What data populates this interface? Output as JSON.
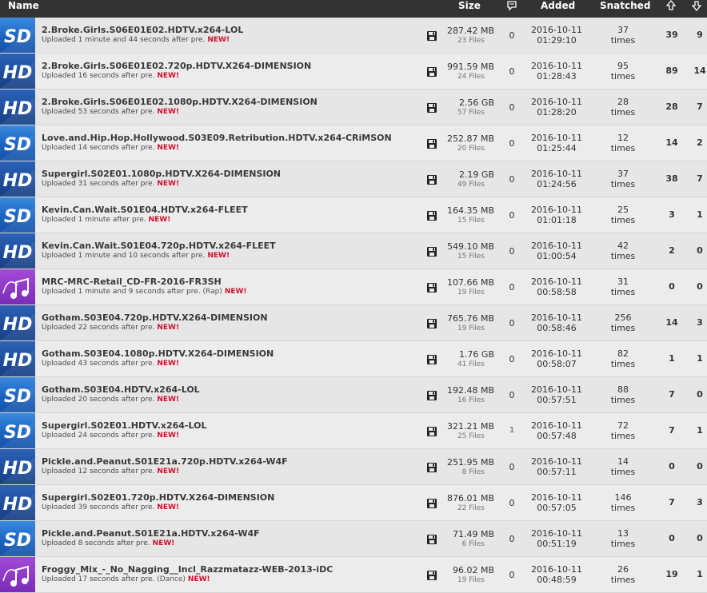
{
  "header": {
    "name": "Name",
    "size": "Size",
    "added": "Added",
    "snatched": "Snatched",
    "comments_icon": "comment-icon",
    "seeders_icon": "arrow-up-icon",
    "leechers_icon": "arrow-down-icon"
  },
  "colors": {
    "header_bg": "#333333",
    "new_badge": "#d0112b",
    "sd_badge": "#1b63c0",
    "hd_badge": "#1e4c9a",
    "music_badge": "#7a2cb7"
  },
  "torrents": [
    {
      "category": "sd",
      "title": "2.Broke.Girls.S06E01E02.HDTV.x264-LOL",
      "uploaded": "Uploaded 1 minute and 44 seconds after pre.",
      "tag": "",
      "new": "NEW!",
      "size": "287.42 MB",
      "files": "23 Files",
      "comments": "0",
      "date": "2016-10-11",
      "time": "01:29:10",
      "snatched": "37",
      "snatched_unit": "times",
      "seeders": "39",
      "leechers": "9"
    },
    {
      "category": "hd",
      "title": "2.Broke.Girls.S06E01E02.720p.HDTV.X264-DIMENSION",
      "uploaded": "Uploaded 16 seconds after pre.",
      "tag": "",
      "new": "NEW!",
      "size": "991.59 MB",
      "files": "24 Files",
      "comments": "0",
      "date": "2016-10-11",
      "time": "01:28:43",
      "snatched": "95",
      "snatched_unit": "times",
      "seeders": "89",
      "leechers": "14"
    },
    {
      "category": "hd",
      "title": "2.Broke.Girls.S06E01E02.1080p.HDTV.X264-DIMENSION",
      "uploaded": "Uploaded 53 seconds after pre.",
      "tag": "",
      "new": "NEW!",
      "size": "2.56 GB",
      "files": "57 Files",
      "comments": "0",
      "date": "2016-10-11",
      "time": "01:28:20",
      "snatched": "28",
      "snatched_unit": "times",
      "seeders": "28",
      "leechers": "7"
    },
    {
      "category": "sd",
      "title": "Love.and.Hip.Hop.Hollywood.S03E09.Retribution.HDTV.x264-CRiMSON",
      "uploaded": "Uploaded 14 seconds after pre.",
      "tag": "",
      "new": "NEW!",
      "size": "252.87 MB",
      "files": "20 Files",
      "comments": "0",
      "date": "2016-10-11",
      "time": "01:25:44",
      "snatched": "12",
      "snatched_unit": "times",
      "seeders": "14",
      "leechers": "2"
    },
    {
      "category": "hd",
      "title": "Supergirl.S02E01.1080p.HDTV.X264-DIMENSION",
      "uploaded": "Uploaded 31 seconds after pre.",
      "tag": "",
      "new": "NEW!",
      "size": "2.19 GB",
      "files": "49 Files",
      "comments": "0",
      "date": "2016-10-11",
      "time": "01:24:56",
      "snatched": "37",
      "snatched_unit": "times",
      "seeders": "38",
      "leechers": "7"
    },
    {
      "category": "sd",
      "title": "Kevin.Can.Wait.S01E04.HDTV.x264-FLEET",
      "uploaded": "Uploaded 1 minute after pre.",
      "tag": "",
      "new": "NEW!",
      "size": "164.35 MB",
      "files": "15 Files",
      "comments": "0",
      "date": "2016-10-11",
      "time": "01:01:18",
      "snatched": "25",
      "snatched_unit": "times",
      "seeders": "3",
      "leechers": "1"
    },
    {
      "category": "hd",
      "title": "Kevin.Can.Wait.S01E04.720p.HDTV.x264-FLEET",
      "uploaded": "Uploaded 1 minute and 10 seconds after pre.",
      "tag": "",
      "new": "NEW!",
      "size": "549.10 MB",
      "files": "15 Files",
      "comments": "0",
      "date": "2016-10-11",
      "time": "01:00:54",
      "snatched": "42",
      "snatched_unit": "times",
      "seeders": "2",
      "leechers": "0"
    },
    {
      "category": "music",
      "title": "MRC-MRC-Retail_CD-FR-2016-FR3SH",
      "uploaded": "Uploaded 1 minute and 9 seconds after pre.",
      "tag": "(Rap)",
      "new": "NEW!",
      "size": "107.66 MB",
      "files": "19 Files",
      "comments": "0",
      "date": "2016-10-11",
      "time": "00:58:58",
      "snatched": "31",
      "snatched_unit": "times",
      "seeders": "0",
      "leechers": "0"
    },
    {
      "category": "hd",
      "title": "Gotham.S03E04.720p.HDTV.X264-DIMENSION",
      "uploaded": "Uploaded 22 seconds after pre.",
      "tag": "",
      "new": "NEW!",
      "size": "765.76 MB",
      "files": "19 Files",
      "comments": "0",
      "date": "2016-10-11",
      "time": "00:58:46",
      "snatched": "256",
      "snatched_unit": "times",
      "seeders": "14",
      "leechers": "3"
    },
    {
      "category": "hd",
      "title": "Gotham.S03E04.1080p.HDTV.X264-DIMENSION",
      "uploaded": "Uploaded 43 seconds after pre.",
      "tag": "",
      "new": "NEW!",
      "size": "1.76 GB",
      "files": "41 Files",
      "comments": "0",
      "date": "2016-10-11",
      "time": "00:58:07",
      "snatched": "82",
      "snatched_unit": "times",
      "seeders": "1",
      "leechers": "1"
    },
    {
      "category": "sd",
      "title": "Gotham.S03E04.HDTV.x264-LOL",
      "uploaded": "Uploaded 20 seconds after pre.",
      "tag": "",
      "new": "NEW!",
      "size": "192.48 MB",
      "files": "16 Files",
      "comments": "0",
      "date": "2016-10-11",
      "time": "00:57:51",
      "snatched": "88",
      "snatched_unit": "times",
      "seeders": "7",
      "leechers": "0"
    },
    {
      "category": "sd",
      "title": "Supergirl.S02E01.HDTV.x264-LOL",
      "uploaded": "Uploaded 24 seconds after pre.",
      "tag": "",
      "new": "NEW!",
      "size": "321.21 MB",
      "files": "25 Files",
      "comments": "1",
      "date": "2016-10-11",
      "time": "00:57:48",
      "snatched": "72",
      "snatched_unit": "times",
      "seeders": "7",
      "leechers": "1"
    },
    {
      "category": "hd",
      "title": "Pickle.and.Peanut.S01E21a.720p.HDTV.x264-W4F",
      "uploaded": "Uploaded 12 seconds after pre.",
      "tag": "",
      "new": "NEW!",
      "size": "251.95 MB",
      "files": "8 Files",
      "comments": "0",
      "date": "2016-10-11",
      "time": "00:57:11",
      "snatched": "14",
      "snatched_unit": "times",
      "seeders": "0",
      "leechers": "0"
    },
    {
      "category": "hd",
      "title": "Supergirl.S02E01.720p.HDTV.X264-DIMENSION",
      "uploaded": "Uploaded 39 seconds after pre.",
      "tag": "",
      "new": "NEW!",
      "size": "876.01 MB",
      "files": "22 Files",
      "comments": "0",
      "date": "2016-10-11",
      "time": "00:57:05",
      "snatched": "146",
      "snatched_unit": "times",
      "seeders": "7",
      "leechers": "3"
    },
    {
      "category": "sd",
      "title": "Pickle.and.Peanut.S01E21a.HDTV.x264-W4F",
      "uploaded": "Uploaded 8 seconds after pre.",
      "tag": "",
      "new": "NEW!",
      "size": "71.49 MB",
      "files": "6 Files",
      "comments": "0",
      "date": "2016-10-11",
      "time": "00:51:19",
      "snatched": "13",
      "snatched_unit": "times",
      "seeders": "0",
      "leechers": "0"
    },
    {
      "category": "music",
      "title": "Froggy_Mix_-_No_Nagging__Incl_Razzmatazz-WEB-2013-iDC",
      "uploaded": "Uploaded 17 seconds after pre.",
      "tag": "(Dance)",
      "new": "NEW!",
      "size": "96.02 MB",
      "files": "19 Files",
      "comments": "0",
      "date": "2016-10-11",
      "time": "00:48:59",
      "snatched": "26",
      "snatched_unit": "times",
      "seeders": "19",
      "leechers": "1"
    }
  ]
}
